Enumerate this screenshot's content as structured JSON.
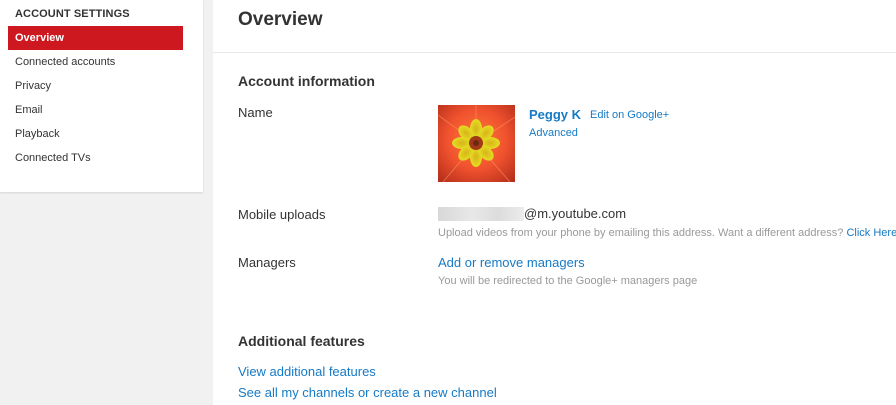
{
  "sidebar": {
    "heading": "ACCOUNT SETTINGS",
    "items": [
      {
        "label": "Overview",
        "active": true
      },
      {
        "label": "Connected accounts",
        "active": false
      },
      {
        "label": "Privacy",
        "active": false
      },
      {
        "label": "Email",
        "active": false
      },
      {
        "label": "Playback",
        "active": false
      },
      {
        "label": "Connected TVs",
        "active": false
      }
    ]
  },
  "main": {
    "title": "Overview",
    "account_info": {
      "heading": "Account information",
      "name_label": "Name",
      "user_name": "Peggy K",
      "edit_link": "Edit on Google+",
      "advanced_link": "Advanced",
      "mobile_label": "Mobile uploads",
      "mobile_email_domain": "@m.youtube.com",
      "mobile_hint": "Upload videos from your phone by emailing this address. Want a different address?",
      "mobile_hint_link": "Click Here",
      "managers_label": "Managers",
      "managers_link": "Add or remove managers",
      "managers_hint": "You will be redirected to the Google+ managers page"
    },
    "additional": {
      "heading": "Additional features",
      "view_link": "View additional features",
      "channels_link": "See all my channels or create a new channel"
    }
  },
  "colors": {
    "accent_red": "#cc181e",
    "link_blue": "#167ac6"
  }
}
